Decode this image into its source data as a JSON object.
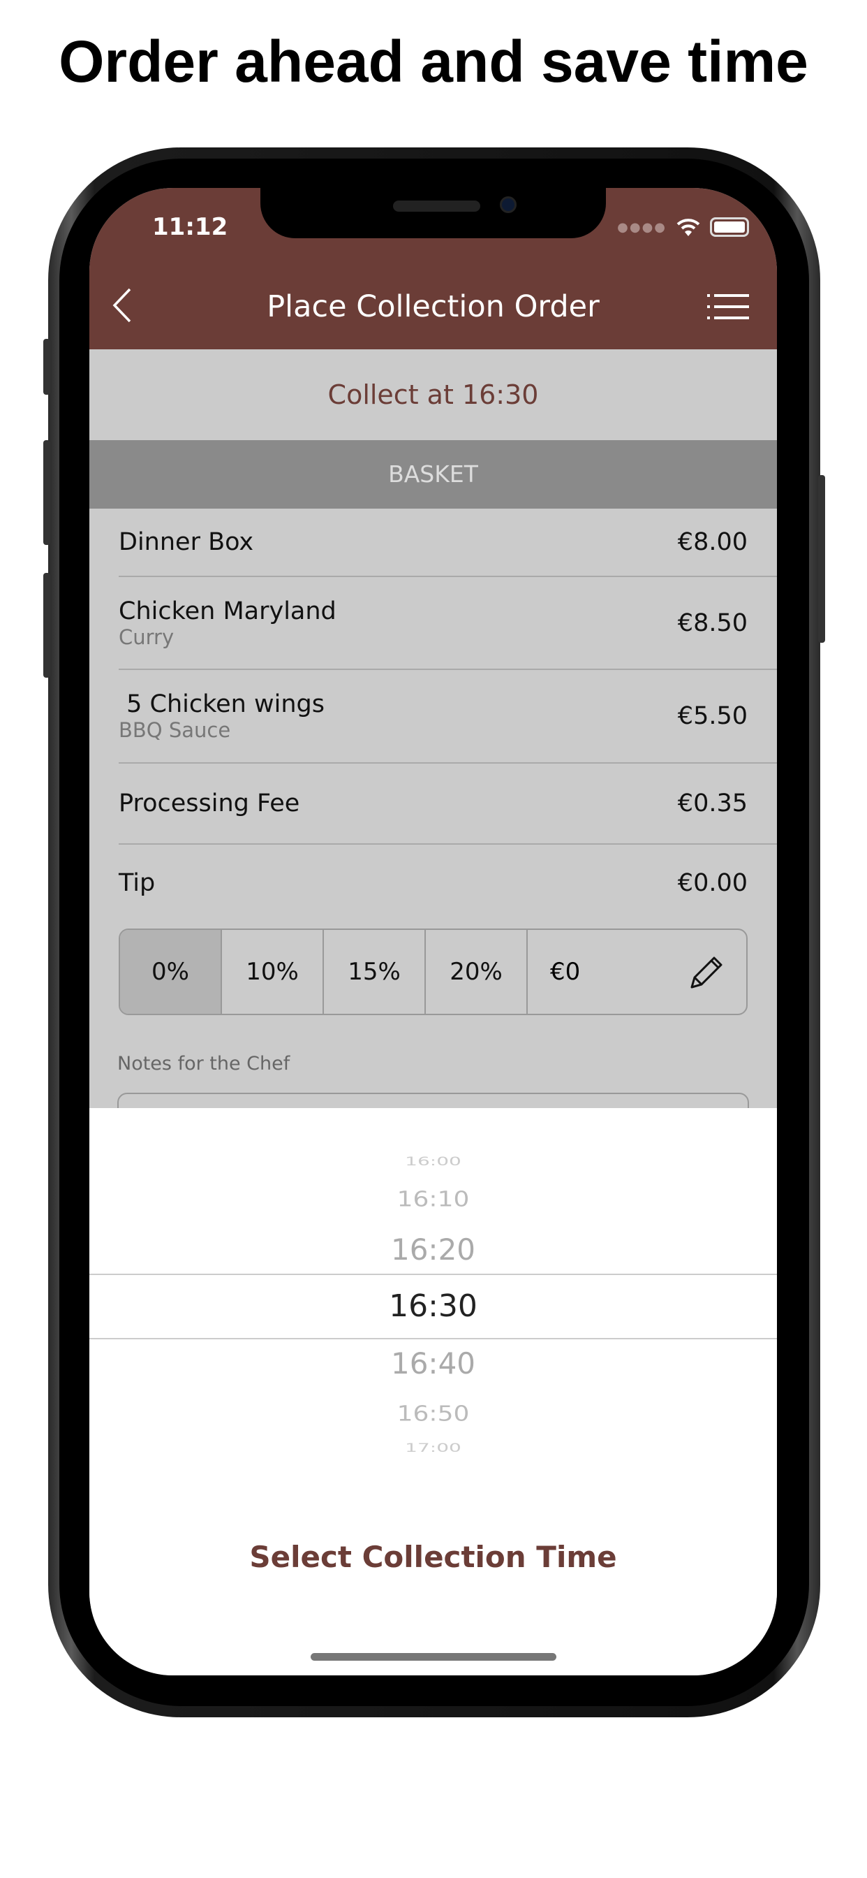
{
  "headline": "Order ahead and save time",
  "status_bar": {
    "time": "11:12",
    "signal_icon": "signal-dots-icon",
    "wifi_icon": "wifi-icon",
    "battery_icon": "battery-icon"
  },
  "header": {
    "title": "Place Collection Order",
    "back_icon": "chevron-left-icon",
    "menu_icon": "list-menu-icon",
    "color": "#6b3d37"
  },
  "collect_label": "Collect at 16:30",
  "basket": {
    "label": "BASKET",
    "items": [
      {
        "name": "Dinner Box",
        "sub": "",
        "price": "€8.00"
      },
      {
        "name": "Chicken Maryland",
        "sub": "Curry",
        "price": "€8.50"
      },
      {
        "name": " 5 Chicken wings",
        "sub": "BBQ Sauce",
        "price": "€5.50"
      },
      {
        "name": "Processing Fee",
        "sub": "",
        "price": "€0.35"
      },
      {
        "name": "Tip",
        "sub": "",
        "price": "€0.00"
      }
    ]
  },
  "tip_options": [
    "0%",
    "10%",
    "15%",
    "20%"
  ],
  "tip_selected": "0%",
  "tip_custom": "€0",
  "notes_label": "Notes for the Chef",
  "picker": {
    "times": [
      "16:00",
      "16:10",
      "16:20",
      "16:30",
      "16:40",
      "16:50",
      "17:00"
    ],
    "selected": "16:30"
  },
  "select_button": "Select Collection Time"
}
